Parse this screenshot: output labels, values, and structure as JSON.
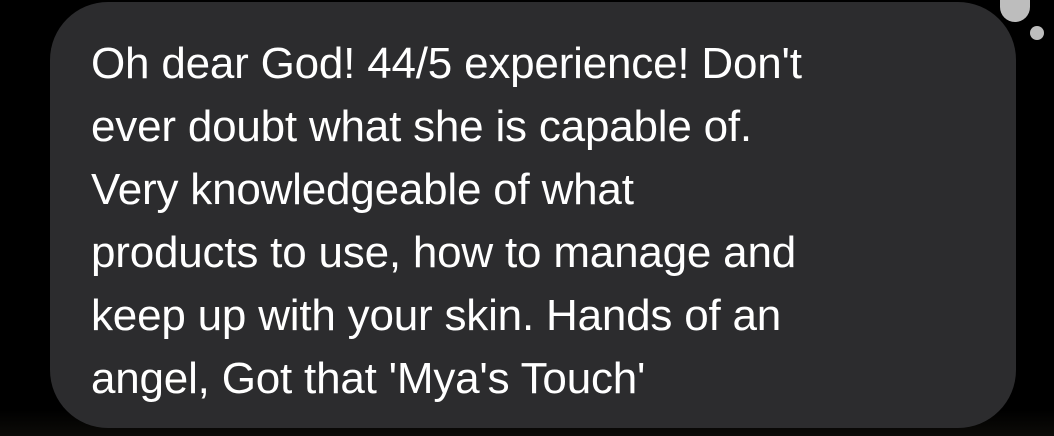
{
  "message": {
    "lines": [
      "Oh dear God! 44/5 experience! Don't",
      "ever doubt what she is capable of.",
      "Very knowledgeable of what",
      "products to use, how to manage and",
      "keep up with your skin. Hands of an",
      "angel, Got that 'Mya's Touch'"
    ]
  },
  "colors": {
    "bubble": "#2c2c2e",
    "text": "#ffffff",
    "background": "#000000",
    "indicator": "#bdbdbd"
  }
}
